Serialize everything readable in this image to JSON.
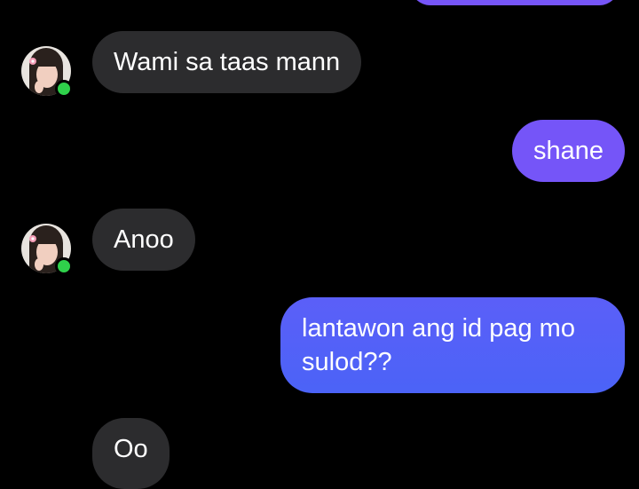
{
  "theme": {
    "incoming_bubble": "#2c2c2e",
    "outgoing_top": "#7655f8",
    "outgoing_bottom": "#4b63f7",
    "online_color": "#2fd14b"
  },
  "contact": {
    "avatar_icon": "contact-photo",
    "online": true
  },
  "messages": [
    {
      "from": "me",
      "text": ""
    },
    {
      "from": "them",
      "text": "Wami sa taas mann"
    },
    {
      "from": "me",
      "text": "shane"
    },
    {
      "from": "them",
      "text": "Anoo"
    },
    {
      "from": "me",
      "text": "lantawon ang id pag mo sulod??"
    },
    {
      "from": "them",
      "text": "Oo"
    }
  ]
}
